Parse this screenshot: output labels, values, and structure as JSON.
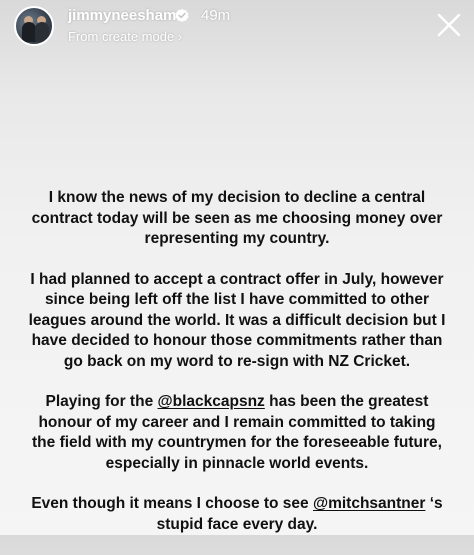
{
  "header": {
    "username": "jimmyneesham",
    "time": "49m",
    "subline": "From create mode",
    "avatar": "profile-photo",
    "verified_icon": "verified-badge-icon",
    "close_icon": "close-icon"
  },
  "story": {
    "p1_lines": [
      "I know the news of my decision to decline a central",
      "contract today will be seen as me choosing money over",
      "representing my country."
    ],
    "p2_lines": [
      "I had planned to accept a contract offer in July, however",
      "since being left off the list I have committed to other",
      "leagues around the world. It was a difficult decision but I",
      "have decided to honour those commitments rather than",
      "go back on my word to re-sign with NZ Cricket."
    ],
    "p3": {
      "l1_pre": "Playing for the ",
      "mention": "@blackcapsnz",
      "l1_post": " has been the greatest",
      "l2": "honour of my career and I remain committed to taking",
      "l3": "the field with my countrymen for the foreseeable future,",
      "l4": "especially in pinnacle world events."
    },
    "p4": {
      "l1_pre": "Even though it means I choose to see ",
      "mention": "@mitchsantner",
      "l1_post": " ‘s",
      "l2": "stupid face every day."
    }
  }
}
